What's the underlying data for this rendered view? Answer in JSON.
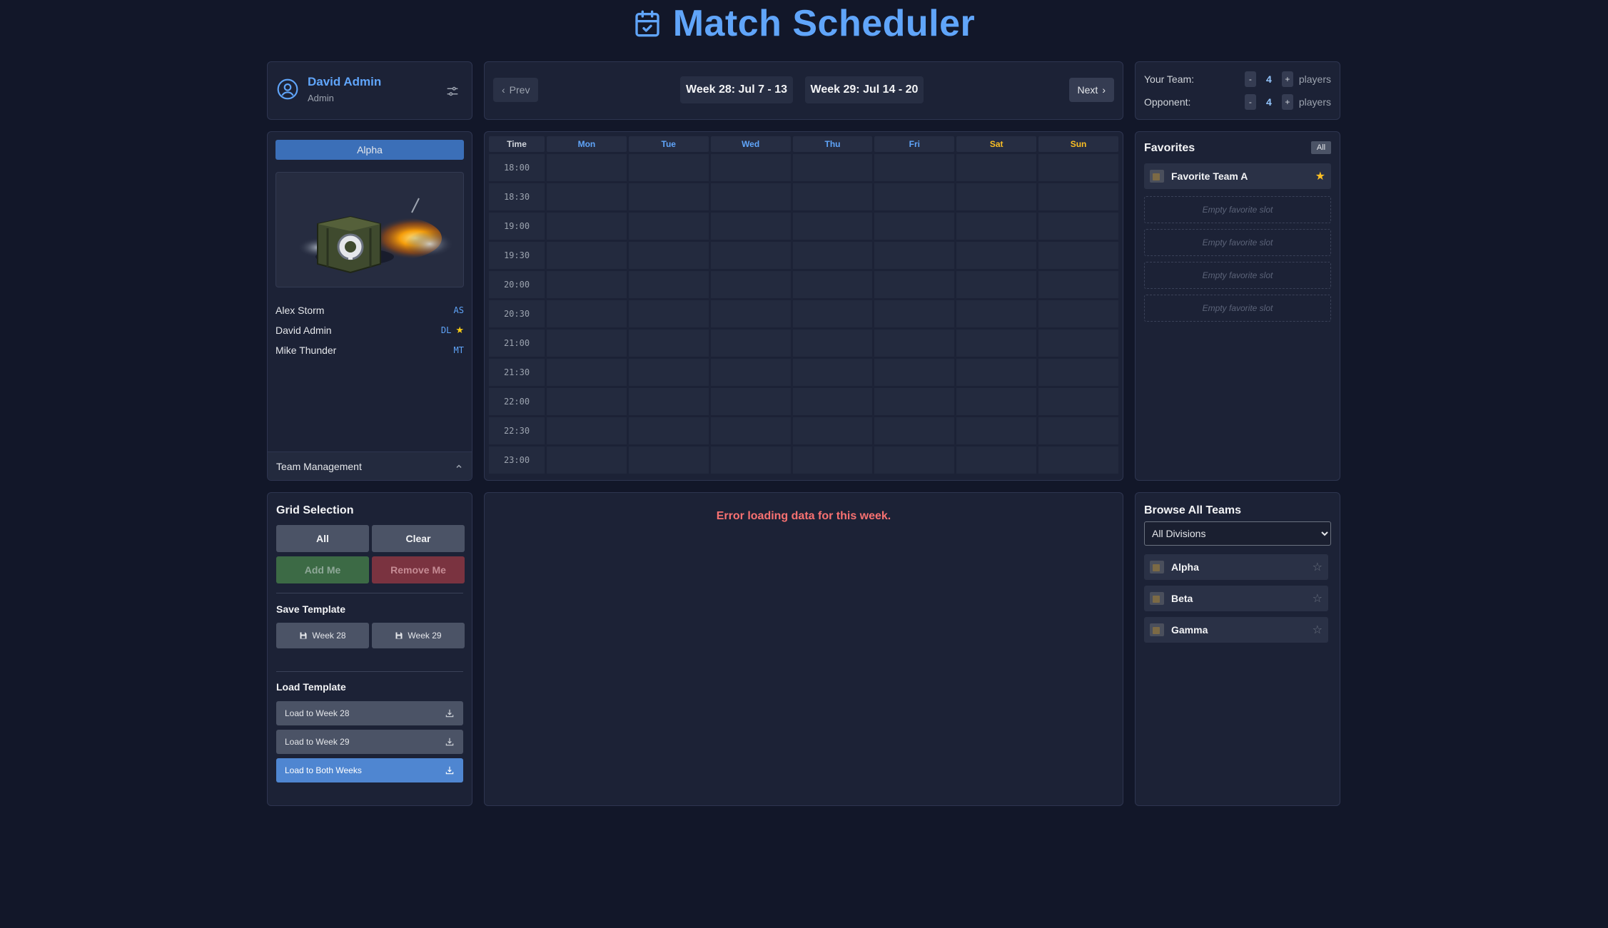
{
  "app": {
    "title": "Match Scheduler"
  },
  "user": {
    "name": "David Admin",
    "role": "Admin"
  },
  "week_nav": {
    "prev_label": "Prev",
    "next_label": "Next",
    "weeks": [
      "Week 28: Jul 7 - 13",
      "Week 29: Jul 14 - 20"
    ]
  },
  "team_size": {
    "your_team_label": "Your Team:",
    "opponent_label": "Opponent:",
    "your_team_value": "4",
    "opponent_value": "4",
    "unit": "players",
    "minus": "-",
    "plus": "+"
  },
  "team_card": {
    "team_name": "Alpha",
    "roster": [
      {
        "name": "Alex Storm",
        "initials": "AS",
        "leader": false
      },
      {
        "name": "David Admin",
        "initials": "DL",
        "leader": true
      },
      {
        "name": "Mike Thunder",
        "initials": "MT",
        "leader": false
      }
    ],
    "management_label": "Team Management"
  },
  "schedule": {
    "time_header": "Time",
    "days": [
      "Mon",
      "Tue",
      "Wed",
      "Thu",
      "Fri",
      "Sat",
      "Sun"
    ],
    "times": [
      "18:00",
      "18:30",
      "19:00",
      "19:30",
      "20:00",
      "20:30",
      "21:00",
      "21:30",
      "22:00",
      "22:30",
      "23:00"
    ],
    "weekday_color": "#60a5fa",
    "weekend_color": "#fbbf24"
  },
  "favorites": {
    "title": "Favorites",
    "all_label": "All",
    "items": [
      "Favorite Team A"
    ],
    "empty_label": "Empty favorite slot",
    "empty_count": 4,
    "star_color": "#fbbf24"
  },
  "grid_selection": {
    "title": "Grid Selection",
    "all_label": "All",
    "clear_label": "Clear",
    "add_me_label": "Add Me",
    "remove_me_label": "Remove Me",
    "save_template_title": "Save Template",
    "save_week_a": "Week 28",
    "save_week_b": "Week 29",
    "load_template_title": "Load Template",
    "load_week_a": "Load to Week 28",
    "load_week_b": "Load to Week 29",
    "load_both": "Load to Both Weeks"
  },
  "center_panel": {
    "error_message": "Error loading data for this week."
  },
  "browse": {
    "title": "Browse All Teams",
    "division_selected": "All Divisions",
    "teams": [
      "Alpha",
      "Beta",
      "Gamma"
    ]
  },
  "colors": {
    "accent": "#60a5fa",
    "background": "#121729",
    "panel": "#1c2236",
    "error": "#f87171"
  }
}
